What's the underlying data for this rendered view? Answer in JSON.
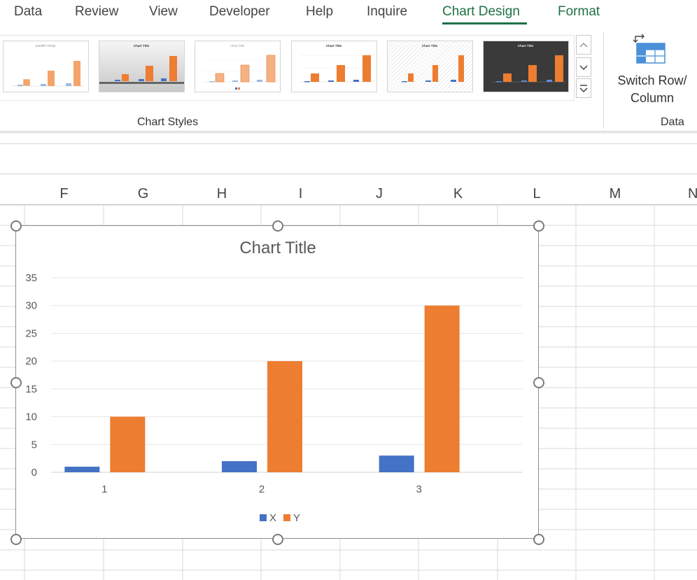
{
  "ribbon": {
    "tabs": [
      {
        "label": "Data",
        "active": false
      },
      {
        "label": "Review",
        "active": false
      },
      {
        "label": "View",
        "active": false
      },
      {
        "label": "Developer",
        "active": false
      },
      {
        "label": "Help",
        "active": false
      },
      {
        "label": "Inquire",
        "active": false
      },
      {
        "label": "Chart Design",
        "active": true
      },
      {
        "label": "Format",
        "active": false
      }
    ],
    "chart_styles_group_label": "Chart Styles",
    "data_group_label": "Data",
    "switch_row_column": {
      "line1": "Switch Row/",
      "line2": "Column"
    },
    "gallery_scroll": {
      "up": "^",
      "down": "⌄",
      "more": "⌄"
    },
    "accent_color": "#1e7145"
  },
  "sheet": {
    "columns": [
      "F",
      "G",
      "H",
      "I",
      "J",
      "K",
      "L",
      "M",
      "N"
    ]
  },
  "chart_data": {
    "type": "bar",
    "title": "Chart Title",
    "categories": [
      "1",
      "2",
      "3"
    ],
    "series": [
      {
        "name": "X",
        "values": [
          1,
          2,
          3
        ],
        "color": "#4472c4"
      },
      {
        "name": "Y",
        "values": [
          10,
          20,
          30
        ],
        "color": "#ed7d31"
      }
    ],
    "ylim": [
      0,
      35
    ],
    "yticks": [
      "0",
      "5",
      "10",
      "15",
      "20",
      "25",
      "30",
      "35"
    ],
    "grid": true,
    "legend": "bottom"
  }
}
